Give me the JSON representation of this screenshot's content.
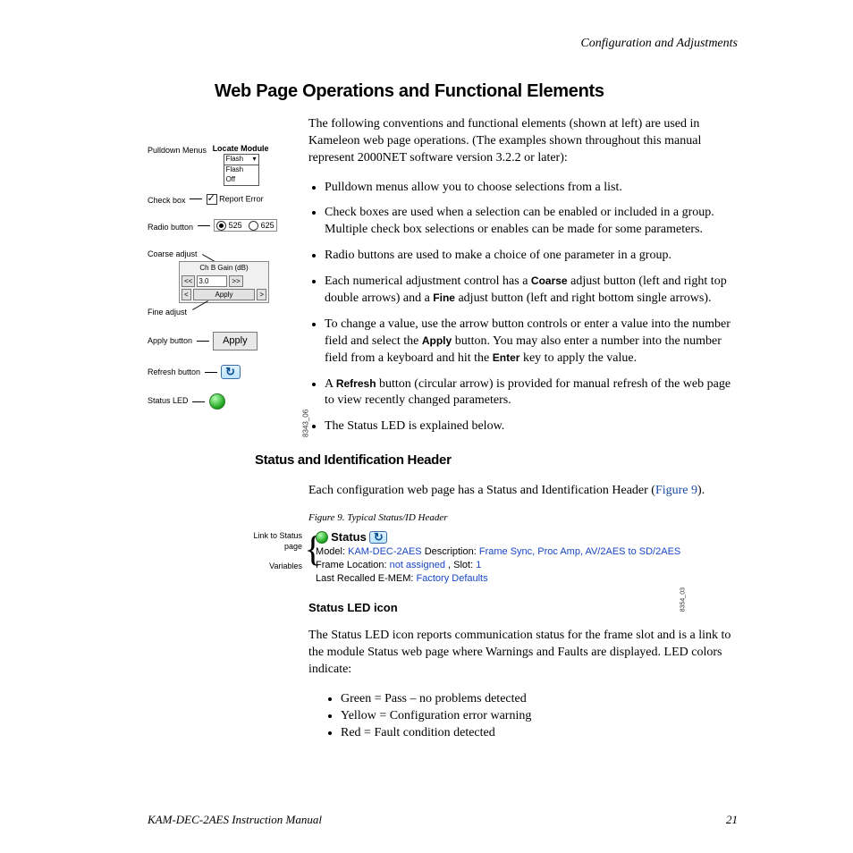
{
  "running_head": "Configuration and Adjustments",
  "h1": "Web Page Operations and Functional Elements",
  "intro": "The following conventions and functional elements (shown at left) are used in Kameleon web page operations. (The examples shown throughout this manual represent 2000NET software version 3.2.2 or later):",
  "bullets": [
    "Pulldown menus allow you to choose selections from a list.",
    "Check boxes are used when a selection can be enabled or included in a group. Multiple check box selections or enables can be made for some parameters.",
    "Radio buttons are used to make a choice of one parameter in a group.",
    {
      "pre": "Each numerical adjustment control has a ",
      "b1": "Coarse",
      "mid1": " adjust button (left and right top double arrows) and a ",
      "b2": "Fine",
      "mid2": " adjust button (left and right bottom single arrows)."
    },
    {
      "pre": "To change a value, use the arrow button controls or enter a value into the number field and select the ",
      "b1": "Apply",
      "mid1": " button. You may also enter a number into the number field from a keyboard and hit the ",
      "b2": "Enter",
      "mid2": " key to apply the value."
    },
    {
      "pre": "A ",
      "b1": "Refresh",
      "mid1": " button (circular arrow) is provided for manual refresh of the web page to view recently changed parameters."
    },
    "The Status LED is explained below."
  ],
  "h2a": "Status and Identification Header",
  "status_p_pre": "Each configuration web page has a Status and Identification Header (",
  "status_p_link": "Figure 9",
  "status_p_post": ").",
  "figcap": "Figure 9.  Typical Status/ID Header",
  "h3a": "Status LED icon",
  "led_p": "The Status LED icon reports communication status for the frame slot and is a link to the module Status web page where Warnings and Faults are displayed. LED colors indicate:",
  "led_list": [
    "Green = Pass – no problems detected",
    "Yellow = Configuration error warning",
    "Red = Fault condition detected"
  ],
  "footer_left": "KAM-DEC-2AES Instruction Manual",
  "footer_page": "21",
  "diagram1": {
    "labels": {
      "pulldown": "Pulldown Menus",
      "checkbox": "Check box",
      "radio": "Radio button",
      "coarse": "Coarse adjust",
      "fine": "Fine adjust",
      "apply": "Apply button",
      "refresh": "Refresh button",
      "led": "Status LED"
    },
    "locate_title": "Locate Module",
    "pulldown_selected": "Flash",
    "pulldown_opts": [
      "Flash",
      "Off"
    ],
    "checkbox_text": "Report Error",
    "radio1": "525",
    "radio2": "625",
    "coarse_title": "Ch B Gain (dB)",
    "coarse_val": "3.0",
    "coarse_apply": "Apply",
    "apply_big": "Apply",
    "sidecode": "8343_06"
  },
  "diagram2": {
    "labels": {
      "link": "Link to Status page",
      "vars": "Variables"
    },
    "status_word": "Status",
    "model_label": "Model:",
    "model_val": "KAM-DEC-2AES",
    "desc_label": "Description:",
    "desc_val": "Frame Sync, Proc Amp, AV/2AES to SD/2AES",
    "frame_label": "Frame Location:",
    "frame_val": "not assigned",
    "slot_label": ", Slot:",
    "slot_val": "1",
    "emem_label": "Last Recalled E-MEM:",
    "emem_val": "Factory Defaults",
    "sidecode": "8354_03"
  }
}
